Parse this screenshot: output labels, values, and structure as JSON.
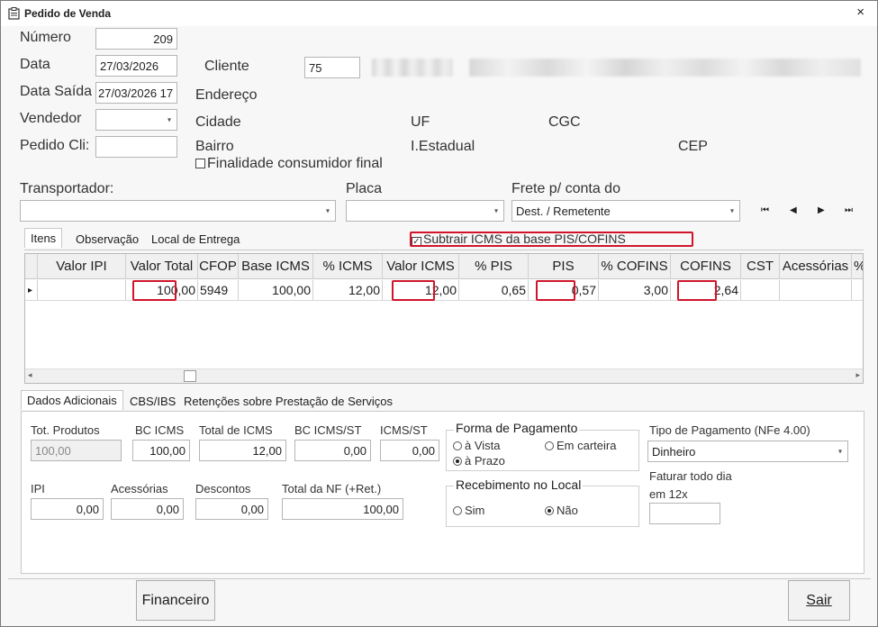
{
  "window": {
    "title": "Pedido de Venda",
    "close": "×"
  },
  "header": {
    "numero_label": "Número",
    "numero_value": "209",
    "data_label": "Data",
    "data_value": "27/03/2026",
    "data_saida_label": "Data Saída",
    "data_saida_value": "27/03/2026 17",
    "vendedor_label": "Vendedor",
    "vendedor_value": "",
    "pedido_cli_label": "Pedido Cli:",
    "pedido_cli_value": "",
    "cliente_label": "Cliente",
    "cliente_value": "75",
    "endereco_label": "Endereço",
    "cidade_label": "Cidade",
    "uf_label": "UF",
    "cgc_label": "CGC",
    "bairro_label": "Bairro",
    "ie_label": "I.Estadual",
    "cep_label": "CEP",
    "finalidade_label": "Finalidade consumidor final",
    "finalidade_checked": false
  },
  "transport": {
    "transportador_label": "Transportador:",
    "transportador_value": "",
    "placa_label": "Placa",
    "placa_value": "",
    "frete_label": "Frete p/ conta do",
    "frete_value": "Dest. / Remetente"
  },
  "nav_buttons": [
    "⏮",
    "◀",
    "▶",
    "⏭"
  ],
  "tabs_top": [
    "Itens",
    "Observação",
    "Local de Entrega"
  ],
  "subtrair_label": "Subtrair ICMS da base PIS/COFINS",
  "subtrair_checked": true,
  "grid": {
    "columns": [
      "Valor IPI",
      "Valor Total",
      "CFOP",
      "Base ICMS",
      "% ICMS",
      "Valor ICMS",
      "% PIS",
      "PIS",
      "% COFINS",
      "COFINS",
      "CST",
      "Acessórias",
      "% CSL"
    ],
    "rows": [
      [
        "",
        "100,00",
        "5949",
        "100,00",
        "12,00",
        "12,00",
        "0,65",
        "0,57",
        "3,00",
        "2,64",
        "",
        "",
        ""
      ]
    ],
    "row_marker": "▸"
  },
  "tabs_bottom": [
    "Dados Adicionais",
    "CBS/IBS",
    "Retenções sobre Prestação de Serviços"
  ],
  "totals": {
    "tot_produtos_label": "Tot. Produtos",
    "tot_produtos": "100,00",
    "bc_icms_label": "BC ICMS",
    "bc_icms": "100,00",
    "total_icms_label": "Total de ICMS",
    "total_icms": "12,00",
    "bc_icms_st_label": "BC ICMS/ST",
    "bc_icms_st": "0,00",
    "icms_st_label": "ICMS/ST",
    "icms_st": "0,00",
    "ipi_label": "IPI",
    "ipi": "0,00",
    "acessorias_label": "Acessórias",
    "acessorias": "0,00",
    "descontos_label": "Descontos",
    "descontos": "0,00",
    "total_nf_label": "Total da NF (+Ret.)",
    "total_nf": "100,00"
  },
  "pagamento": {
    "forma_label": "Forma de Pagamento",
    "a_vista": "à Vista",
    "em_carteira": "Em carteira",
    "a_prazo": "à Prazo",
    "selected": "a_prazo",
    "tipo_label": "Tipo de Pagamento (NFe 4.00)",
    "tipo_value": "Dinheiro",
    "recebimento_label": "Recebimento no Local",
    "sim": "Sim",
    "nao": "Não",
    "recebimento_selected": "nao",
    "faturar_label_1": "Faturar todo dia",
    "faturar_label_2": "em 12x",
    "faturar_value": ""
  },
  "buttons": {
    "financeiro": "Financeiro",
    "sair": "Sair"
  }
}
